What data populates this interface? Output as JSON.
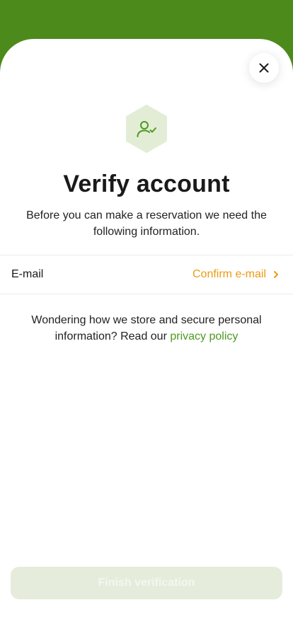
{
  "header": {
    "close_icon": "close-icon"
  },
  "badge": {
    "icon": "user-check-icon",
    "colors": {
      "hex_fill": "#e3edd6",
      "icon_stroke": "#4d9a1f"
    }
  },
  "title": "Verify account",
  "subtitle": "Before you can make a reservation we need the following information.",
  "rows": [
    {
      "label": "E-mail",
      "action_label": "Confirm e-mail",
      "icon": "chevron-right-icon"
    }
  ],
  "privacy": {
    "text": "Wondering how we store and secure personal information? Read our ",
    "link_label": "privacy policy"
  },
  "footer": {
    "finish_label": "Finish verification",
    "disabled": true
  },
  "colors": {
    "brand_green": "#4d8a1c",
    "link_green": "#4d9a1f",
    "accent_orange": "#ec9a13",
    "disabled_button": "#e6ecdc"
  }
}
